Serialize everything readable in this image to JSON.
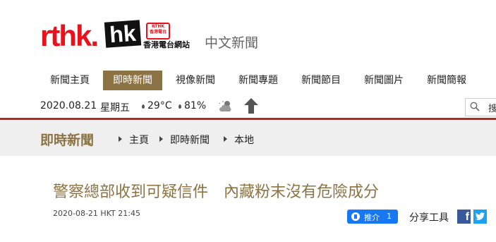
{
  "header": {
    "logo_main": "rthk.",
    "logo_hk": "hk",
    "logo_badge_top": "RTHK",
    "logo_badge_bottom": "香港電台",
    "logo_sub": "香港電台網站",
    "section": "中文新聞"
  },
  "nav": {
    "items": [
      {
        "label": "新聞主頁"
      },
      {
        "label": "即時新聞",
        "active": true
      },
      {
        "label": "視像新聞"
      },
      {
        "label": "新聞專題"
      },
      {
        "label": "新聞節目"
      },
      {
        "label": "新聞圖片"
      },
      {
        "label": "新聞簡報"
      }
    ]
  },
  "infobar": {
    "date": "2020.08.21",
    "weekday": "星期五",
    "temperature": "29°C",
    "humidity": "81%",
    "weather_icon": "cloudy-moon-icon",
    "signal_icon": "upward-arrow-icon",
    "search_text": "搜"
  },
  "banner": {
    "title": "即時新聞",
    "breadcrumb": [
      "主頁",
      "即時新聞",
      "本地"
    ]
  },
  "article": {
    "headline": "警察總部收到可疑信件　內藏粉末沒有危險成分",
    "timestamp": "2020-08-21 HKT 21:45",
    "like_label": "推介",
    "like_count": "1",
    "share_label": "分享工具",
    "share_fb_glyph": "f"
  },
  "colors": {
    "brand_red": "#e8121c",
    "accent_gold": "#8c7343",
    "divider_red": "#b22a1f",
    "facebook_blue": "#1877f2",
    "twitter_blue": "#1da1f2"
  }
}
